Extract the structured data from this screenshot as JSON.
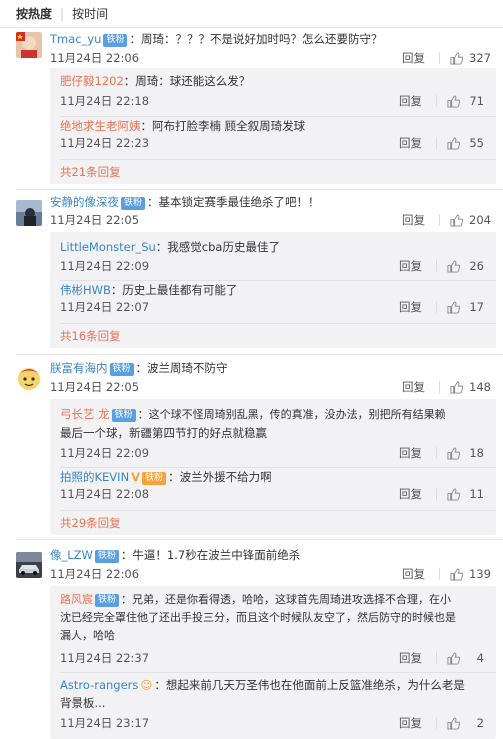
{
  "sort": {
    "hot": "按热度",
    "time": "按时间"
  },
  "ui": {
    "reply": "回复"
  },
  "comments": [
    {
      "user": "Tmac_yu",
      "badge": "铁粉",
      "text": "：周琦：？？？不是说好加时吗？怎么还要防守？",
      "time": "11月24日 22:06",
      "likes": "327",
      "replies": [
        {
          "user": "肥仔毅1202",
          "text": "：周琦：球还能这么发？",
          "time": "11月24日 22:18",
          "likes": "71"
        },
        {
          "user": "绝地求生老阿姨",
          "text": "：阿布打脸李楠 顾全叙周琦发球",
          "time": "11月24日 22:23",
          "likes": "55"
        }
      ],
      "more": "共21条回复"
    },
    {
      "user": "安静的像深夜",
      "badge": "铁粉",
      "text": "：基本锁定赛季最佳绝杀了吧！！",
      "time": "11月24日 22:05",
      "likes": "204",
      "replies": [
        {
          "user": "LittleMonster_Su",
          "text": "：我感觉cba历史最佳了",
          "time": "11月24日 22:09",
          "likes": "26"
        },
        {
          "user": "伟彬HWB",
          "text": "：历史上最佳都有可能了",
          "time": "11月24日 22:07",
          "likes": "17"
        }
      ],
      "more": "共16条回复"
    },
    {
      "user": "朕富有海内",
      "badge": "铁粉",
      "text": "：波兰周琦不防守",
      "time": "11月24日 22:05",
      "likes": "148",
      "replies": [
        {
          "user": "弓长艺how龙",
          "user_display": "弓长艺 龙",
          "badge": "铁粉",
          "text_line1": "：这个球不怪周琦别乱黑，传的真准，没办法，别把所有结果赖",
          "text_line2": "最后一个球，新疆第四节打的好点就稳赢",
          "time": "11月24日 22:09",
          "likes": "18"
        },
        {
          "user": "拍照的KEVIN",
          "badge": "铁粉",
          "text": "：波兰外援不给力啊",
          "time": "11月24日 22:08",
          "likes": "11"
        }
      ],
      "more": "共29条回复"
    },
    {
      "user": "像_LZW",
      "badge": "铁粉",
      "text": "：牛逼！1.7秒在波兰中锋面前绝杀",
      "time": "11月24日 22:06",
      "likes": "139",
      "replies": [
        {
          "user": "路风宸",
          "badge": "铁粉",
          "text_line1": "：兄弟，还是你看得透，哈哈，这球首先周琦进攻选择不合理，在小",
          "text_line2": "沈已经完全罩住他了还出手投三分，而且这个时候队友空了，然后防守的时候也是",
          "text_line3": "漏人，哈哈",
          "time": "11月24日 22:37",
          "likes": "4"
        },
        {
          "user": "Astro-rangers",
          "text_line1": "：想起来前几天万圣伟也在他面前上反篮准绝杀，为什么老是",
          "text_line2": "背景板...",
          "time": "11月24日 23:17",
          "likes": "2"
        }
      ]
    }
  ]
}
